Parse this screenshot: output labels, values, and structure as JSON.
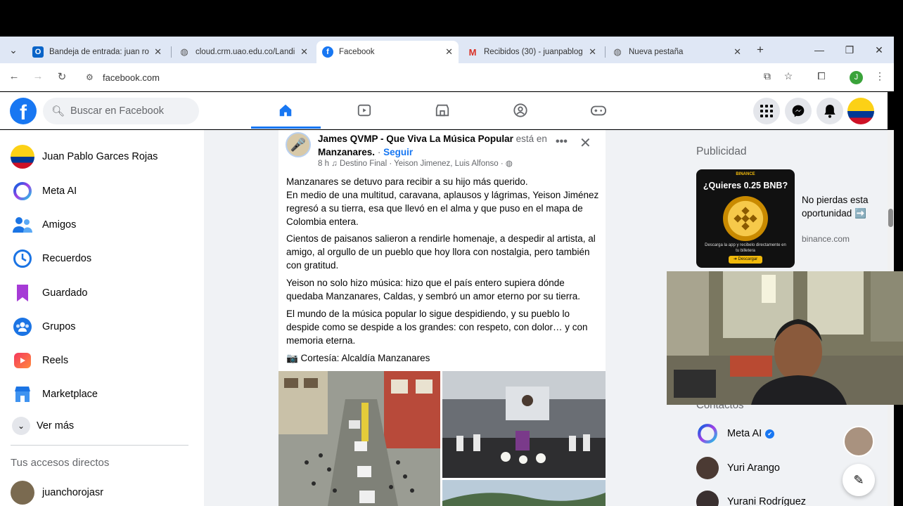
{
  "browser": {
    "tabs": [
      {
        "icon": "outlook-icon",
        "title": "Bandeja de entrada: juan ro",
        "active": false
      },
      {
        "icon": "globe-icon",
        "title": "cloud.crm.uao.edu.co/Landi",
        "active": false
      },
      {
        "icon": "facebook-icon",
        "title": "Facebook",
        "active": true
      },
      {
        "icon": "gmail-icon",
        "title": "Recibidos (30) - juanpablog",
        "active": false
      },
      {
        "icon": "chrome-icon",
        "title": "Nueva pestaña",
        "active": false
      }
    ],
    "url": "facebook.com",
    "profile_initial": "J"
  },
  "facebook": {
    "search_placeholder": "Buscar en Facebook",
    "sidebar": {
      "items": [
        {
          "label": "Juan Pablo Garces Rojas",
          "icon": "profile-avatar"
        },
        {
          "label": "Meta AI",
          "icon": "meta-ai-icon"
        },
        {
          "label": "Amigos",
          "icon": "friends-icon"
        },
        {
          "label": "Recuerdos",
          "icon": "memories-icon"
        },
        {
          "label": "Guardado",
          "icon": "saved-icon"
        },
        {
          "label": "Grupos",
          "icon": "groups-icon"
        },
        {
          "label": "Reels",
          "icon": "reels-icon"
        },
        {
          "label": "Marketplace",
          "icon": "marketplace-icon"
        }
      ],
      "see_more": "Ver más",
      "shortcuts_title": "Tus accesos directos",
      "shortcut_item": "juanchorojasr"
    },
    "post": {
      "author": "James QVMP - Que Viva La Música Popular",
      "location_prefix": "está en",
      "location": "Manzanares.",
      "follow": "Seguir",
      "time": "8 h",
      "song": "♫ Destino Final · Yeison Jimenez, Luis Alfonso ·",
      "paragraphs": [
        "Manzanares se detuvo para recibir a su hijo más querido.\nEn medio de una multitud, caravana, aplausos y lágrimas, Yeison Jiménez regresó a su tierra, esa que llevó en el alma y que puso en el mapa de Colombia entera.",
        "Cientos de paisanos salieron a rendirle homenaje, a despedir al artista, al amigo, al orgullo de un pueblo que hoy llora con nostalgia, pero también con gratitud.",
        "Yeison no solo hizo música: hizo que el país entero supiera dónde quedaba Manzanares, Caldas, y sembró un amor eterno por su tierra.",
        "El mundo de la música popular lo sigue despidiendo, y su pueblo lo despide como se despide a los grandes: con respeto, con dolor… y con memoria eterna.",
        "📷 Cortesía: Alcaldía Manzanares"
      ]
    },
    "ads": {
      "heading": "Publicidad",
      "creative_brand": "BINANCE",
      "creative_title": "¿Quieres 0.25 BNB?",
      "creative_sub": "Descarga la app y recibelo directamente en tu billetera",
      "creative_cta": "➜ Descargar",
      "text": "No pierdas esta oportunidad ➡️",
      "domain": "binance.com"
    },
    "contacts": {
      "heading": "Contactos",
      "items": [
        {
          "name": "Meta AI",
          "verified": "✔"
        },
        {
          "name": "Yuri Arango"
        },
        {
          "name": "Yurani Rodríguez"
        }
      ]
    },
    "colors": {
      "brand": "#1877f2",
      "page_bg": "#f0f2f5"
    }
  }
}
